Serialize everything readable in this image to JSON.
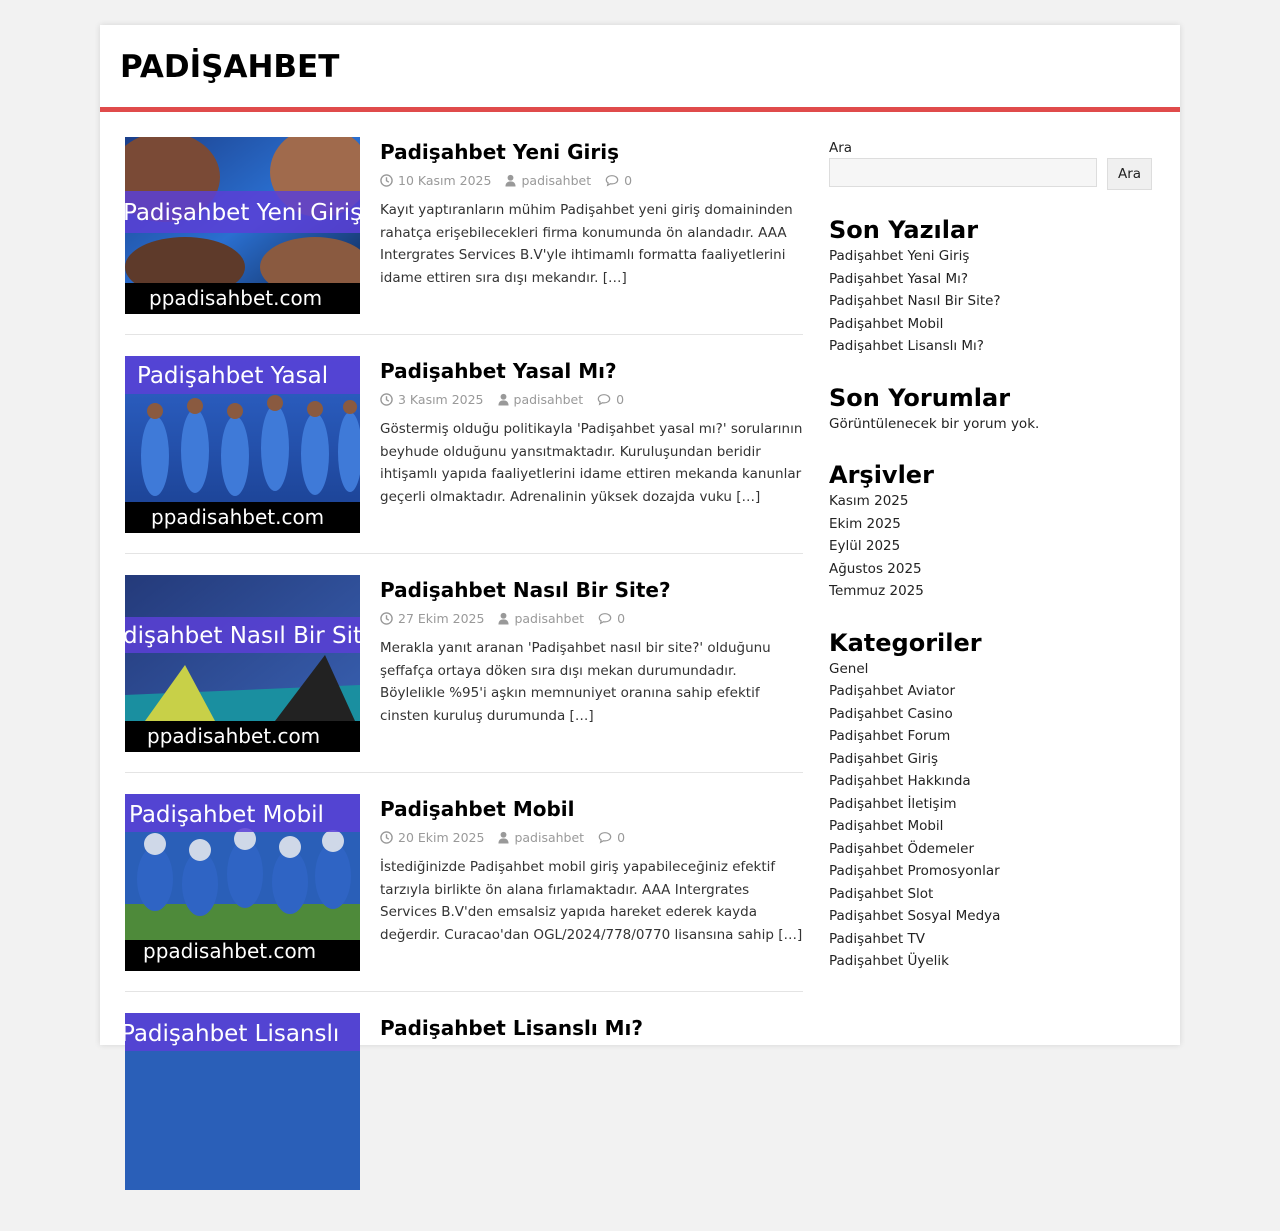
{
  "site": {
    "title": "PADİŞAHBET"
  },
  "posts": [
    {
      "title": "Padişahbet Yeni Giriş",
      "date": "10 Kasım 2025",
      "author": "padisahbet",
      "comments": "0",
      "excerpt": "Kayıt yaptıranların mühim Padişahbet yeni giriş domaininden rahatça erişebilecekleri firma konumunda ön alandadır. AAA Intergrates Services B.V'yle ihtimamlı formatta faaliyetlerini idame ettiren sıra dışı mekandır.",
      "more": "[…]",
      "image_banner": "Padişahbet Yeni Giriş",
      "image_footer": "ppadisahbet.com"
    },
    {
      "title": "Padişahbet Yasal Mı?",
      "date": "3 Kasım 2025",
      "author": "padisahbet",
      "comments": "0",
      "excerpt": "Göstermiş olduğu politikayla 'Padişahbet yasal mı?' sorularının beyhude olduğunu yansıtmaktadır. Kuruluşundan beridir ihtişamlı yapıda faaliyetlerini idame ettiren mekanda kanunlar geçerli olmaktadır. Adrenalinin yüksek dozajda vuku",
      "more": "[…]",
      "image_banner": "Padişahbet Yasal",
      "image_footer": "ppadisahbet.com"
    },
    {
      "title": "Padişahbet Nasıl Bir Site?",
      "date": "27 Ekim 2025",
      "author": "padisahbet",
      "comments": "0",
      "excerpt": "Merakla yanıt aranan 'Padişahbet nasıl bir site?' olduğunu şeffafça ortaya döken sıra dışı mekan durumundadır. Böylelikle %95'i aşkın memnuniyet oranına sahip efektif cinsten kuruluş durumunda",
      "more": "[…]",
      "image_banner": "dişahbet Nasıl Bir Site",
      "image_footer": "ppadisahbet.com"
    },
    {
      "title": "Padişahbet Mobil",
      "date": "20 Ekim 2025",
      "author": "padisahbet",
      "comments": "0",
      "excerpt": "İstediğinizde Padişahbet mobil giriş yapabileceğiniz efektif tarzıyla birlikte ön alana fırlamaktadır. AAA Intergrates Services B.V'den emsalsiz yapıda hareket ederek kayda değerdir. Curacao'dan OGL/2024/778/0770 lisansına sahip",
      "more": "[…]",
      "image_banner": "Padişahbet Mobil",
      "image_footer": "ppadisahbet.com"
    },
    {
      "title": "Padişahbet Lisanslı Mı?",
      "date": "",
      "author": "",
      "comments": "",
      "excerpt": "",
      "more": "",
      "image_banner": "Padişahbet Lisanslı",
      "image_footer": ""
    }
  ],
  "sidebar": {
    "search_label": "Ara",
    "search_button": "Ara",
    "recent_posts": {
      "title": "Son Yazılar",
      "items": [
        "Padişahbet Yeni Giriş",
        "Padişahbet Yasal Mı?",
        "Padişahbet Nasıl Bir Site?",
        "Padişahbet Mobil",
        "Padişahbet Lisanslı Mı?"
      ]
    },
    "recent_comments": {
      "title": "Son Yorumlar",
      "empty": "Görüntülenecek bir yorum yok."
    },
    "archives": {
      "title": "Arşivler",
      "items": [
        "Kasım 2025",
        "Ekim 2025",
        "Eylül 2025",
        "Ağustos 2025",
        "Temmuz 2025"
      ]
    },
    "categories": {
      "title": "Kategoriler",
      "items": [
        "Genel",
        "Padişahbet Aviator",
        "Padişahbet Casino",
        "Padişahbet Forum",
        "Padişahbet Giriş",
        "Padişahbet Hakkında",
        "Padişahbet İletişim",
        "Padişahbet Mobil",
        "Padişahbet Ödemeler",
        "Padişahbet Promosyonlar",
        "Padişahbet Slot",
        "Padişahbet Sosyal Medya",
        "Padişahbet TV",
        "Padişahbet Üyelik"
      ]
    }
  },
  "colors": {
    "accent": "#e04b4b",
    "banner": "#5b3fd6",
    "meta": "#999999"
  },
  "icons": {
    "date": "clock-icon",
    "author": "user-icon",
    "comments": "comment-icon"
  }
}
